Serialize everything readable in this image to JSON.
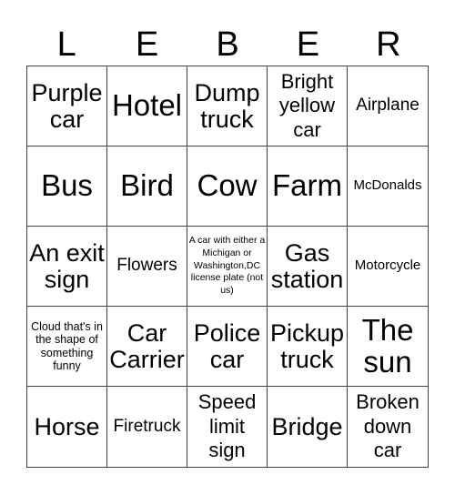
{
  "title_letters": [
    "L",
    "E",
    "B",
    "E",
    "R"
  ],
  "cells": [
    "Purple car",
    "Hotel",
    "Dump truck",
    "Bright yellow car",
    "Airplane",
    "Bus",
    "Bird",
    "Cow",
    "Farm",
    "McDonalds",
    "An exit sign",
    "Flowers",
    "A car with either a Michigan or Washington,DC license plate (not us)",
    "Gas station",
    "Motorcycle",
    "Cloud that's in the shape of something funny",
    "Car Carrier",
    "Police car",
    "Pickup truck",
    "The sun",
    "Horse",
    "Firetruck",
    "Speed limit sign",
    "Bridge",
    "Broken down car"
  ]
}
